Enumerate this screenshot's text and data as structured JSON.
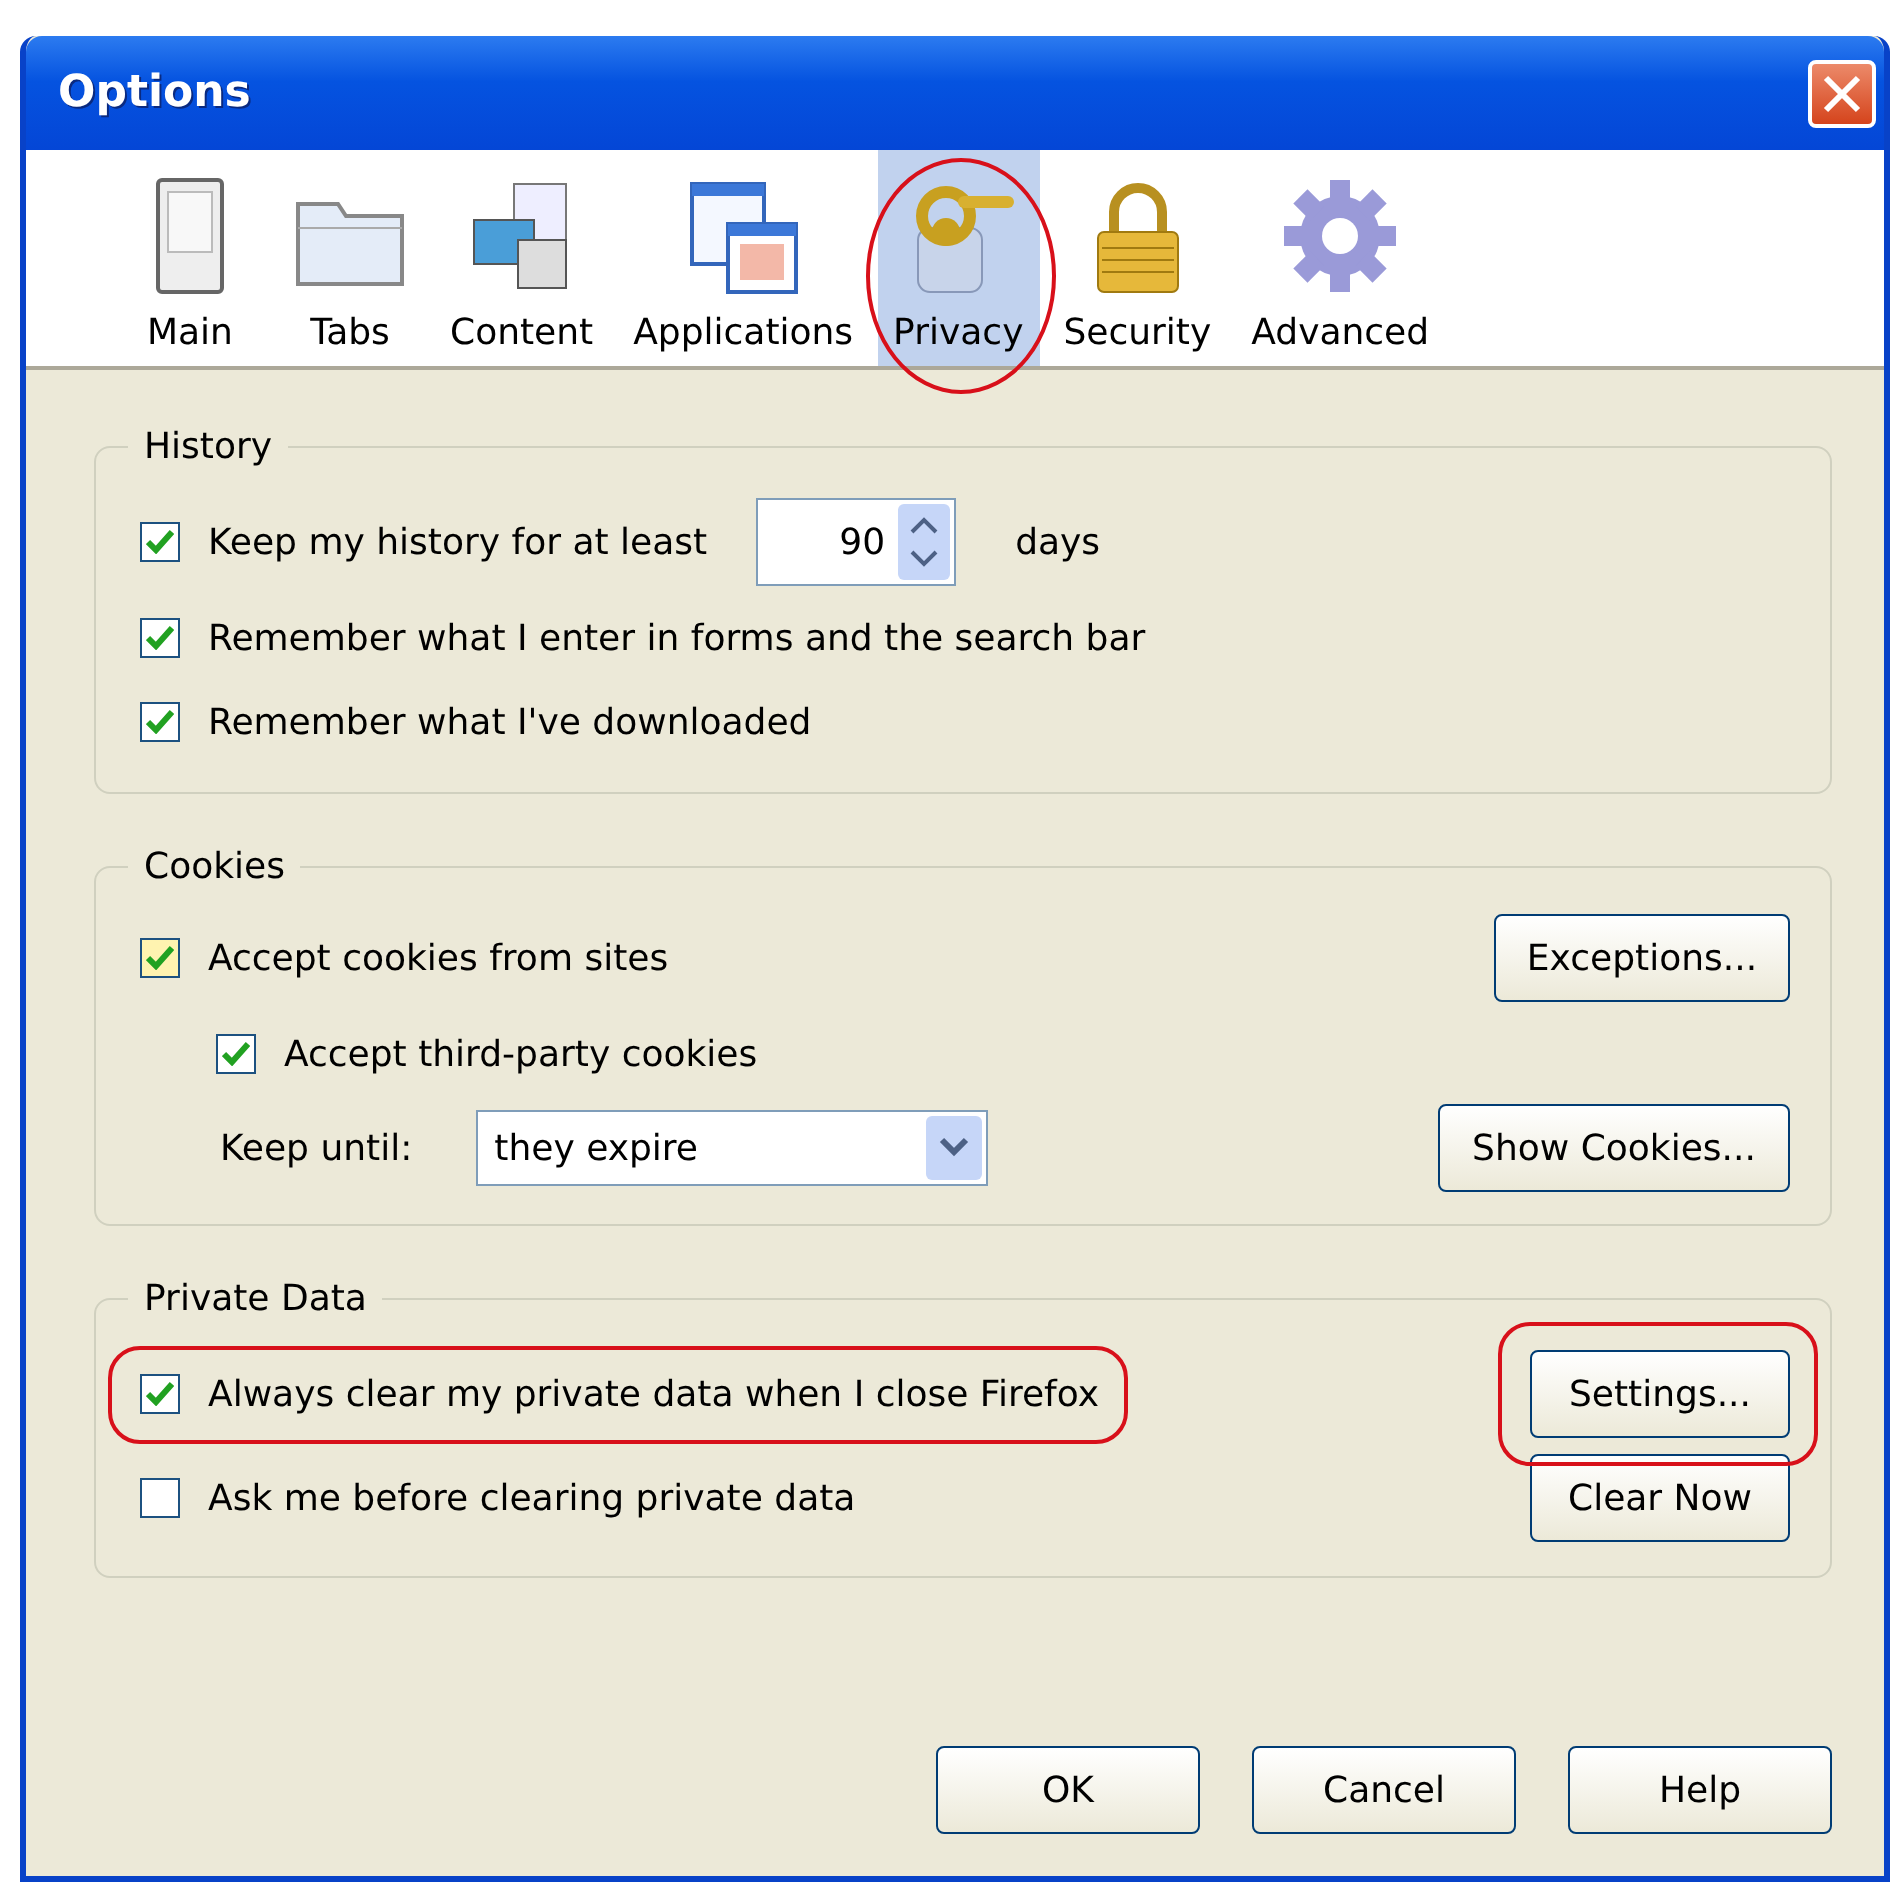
{
  "window": {
    "title": "Options"
  },
  "toolbar": [
    {
      "label": "Main",
      "kind": "switch",
      "selected": false,
      "highlighted": false
    },
    {
      "label": "Tabs",
      "kind": "folder",
      "selected": false,
      "highlighted": false
    },
    {
      "label": "Content",
      "kind": "pages",
      "selected": false,
      "highlighted": false
    },
    {
      "label": "Applications",
      "kind": "windows",
      "selected": false,
      "highlighted": false
    },
    {
      "label": "Privacy",
      "kind": "key",
      "selected": true,
      "highlighted": true
    },
    {
      "label": "Security",
      "kind": "lock",
      "selected": false,
      "highlighted": false
    },
    {
      "label": "Advanced",
      "kind": "gear",
      "selected": false,
      "highlighted": false
    }
  ],
  "history": {
    "title": "History",
    "rows": [
      {
        "kind": "spin",
        "label": "Keep my history for at least",
        "checked": true,
        "value": "90",
        "unit": "days"
      },
      {
        "kind": "check",
        "label": "Remember what I enter in forms and the search bar",
        "checked": true
      },
      {
        "kind": "check",
        "label": "Remember what I've downloaded",
        "checked": true
      }
    ]
  },
  "cookies": {
    "title": "Cookies",
    "accept": {
      "label": "Accept cookies from sites",
      "checked": true
    },
    "exceptions_button": "Exceptions...",
    "third_party": {
      "label": "Accept third-party cookies",
      "checked": true
    },
    "keep_until": {
      "label": "Keep until:",
      "value": "they expire"
    },
    "show_button": "Show Cookies..."
  },
  "private_data": {
    "title": "Private Data",
    "always_clear": {
      "label": "Always clear my private data when I close Firefox",
      "checked": true,
      "highlighted": true
    },
    "settings_button": {
      "label": "Settings...",
      "highlighted": true
    },
    "ask": {
      "label": "Ask me before clearing private data",
      "checked": false
    },
    "clear_button": "Clear Now"
  },
  "buttons": [
    "OK",
    "Cancel",
    "Help"
  ]
}
